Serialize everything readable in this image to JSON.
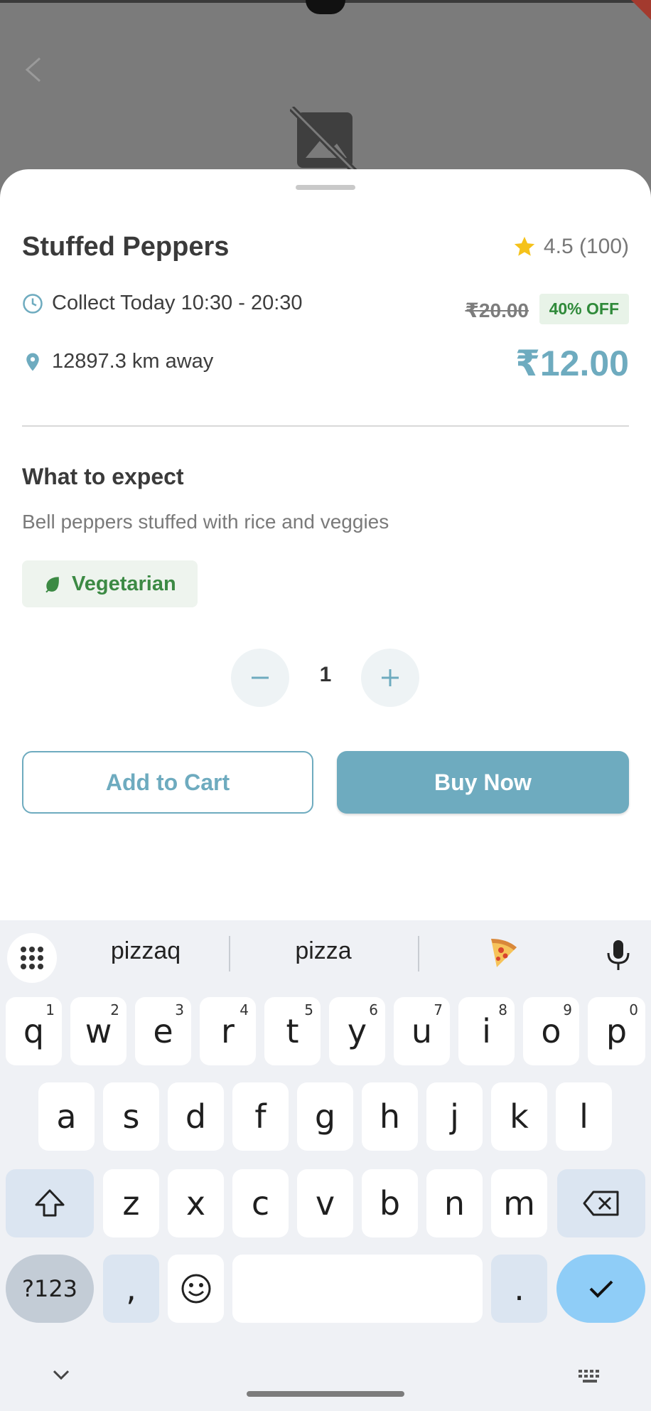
{
  "product": {
    "title": "Stuffed Peppers",
    "rating": "4.5 (100)",
    "collect_time": "Collect Today 10:30 - 20:30",
    "distance": "12897.3 km away",
    "original_price": "₹20.00",
    "discount": "40% OFF",
    "price": "₹12.00"
  },
  "details": {
    "section_title": "What to expect",
    "description": "Bell peppers stuffed with rice and veggies",
    "tag": "Vegetarian"
  },
  "quantity": {
    "value": "1"
  },
  "actions": {
    "add_to_cart": "Add to Cart",
    "buy_now": "Buy Now"
  },
  "colors": {
    "accent": "#6eabbf",
    "discount_green": "#2f8a3a",
    "star": "#f5c21b"
  },
  "keyboard": {
    "suggestions": [
      "pizzaq",
      "pizza"
    ],
    "emoji_suggestion": "pizza-emoji",
    "row1": [
      {
        "key": "q",
        "hint": "1"
      },
      {
        "key": "w",
        "hint": "2"
      },
      {
        "key": "e",
        "hint": "3"
      },
      {
        "key": "r",
        "hint": "4"
      },
      {
        "key": "t",
        "hint": "5"
      },
      {
        "key": "y",
        "hint": "6"
      },
      {
        "key": "u",
        "hint": "7"
      },
      {
        "key": "i",
        "hint": "8"
      },
      {
        "key": "o",
        "hint": "9"
      },
      {
        "key": "p",
        "hint": "0"
      }
    ],
    "row2": [
      "a",
      "s",
      "d",
      "f",
      "g",
      "h",
      "j",
      "k",
      "l"
    ],
    "row3": [
      "z",
      "x",
      "c",
      "v",
      "b",
      "n",
      "m"
    ],
    "symbols_key": "?123",
    "comma_key": ",",
    "period_key": "."
  }
}
